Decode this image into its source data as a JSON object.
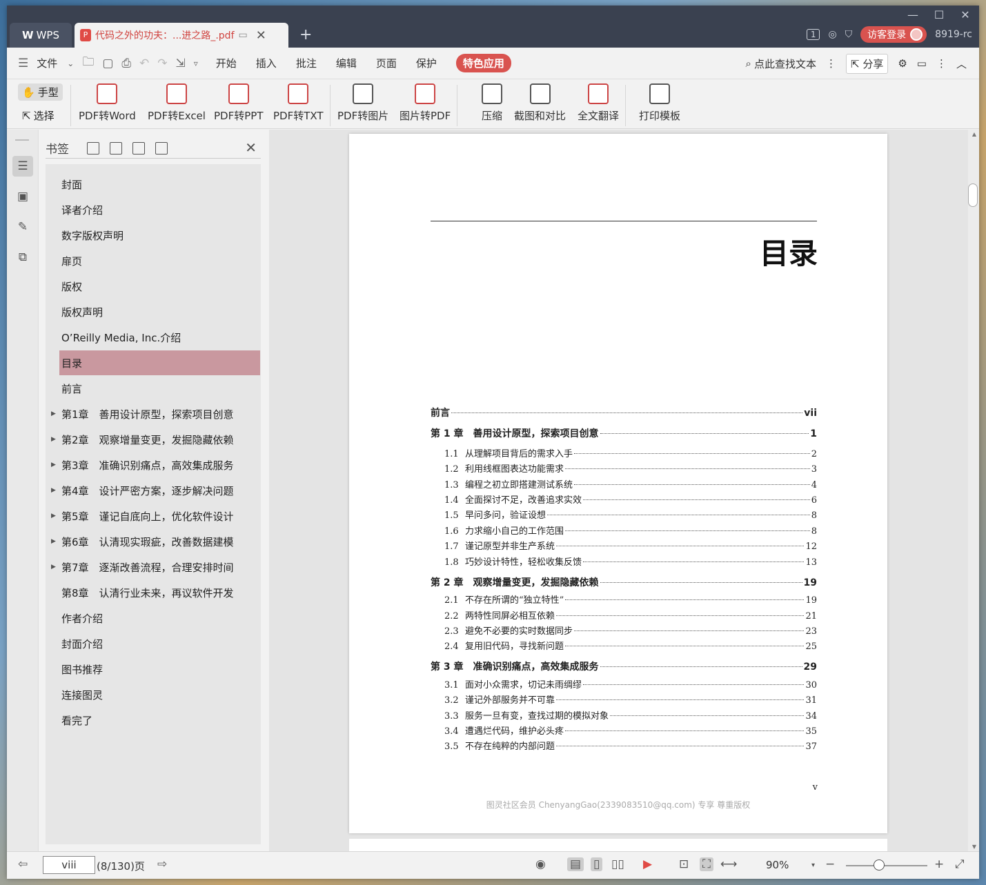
{
  "titlebar": {
    "app_tab": "WPS",
    "doc_tab": "代码之外的功夫：...进之路_.pdf",
    "page_count_badge": "1",
    "login_label": "访客登录",
    "user_code": "8919-rc"
  },
  "menubar": {
    "file_label": "文件",
    "items": [
      "开始",
      "插入",
      "批注",
      "编辑",
      "页面",
      "保护"
    ],
    "special_item": "特色应用",
    "search_label": "点此查找文本",
    "share_label": "分享"
  },
  "ribbon": {
    "hand_label": "手型",
    "select_label": "选择",
    "buttons": [
      "PDF转Word",
      "PDF转Excel",
      "PDF转PPT",
      "PDF转TXT",
      "PDF转图片",
      "图片转PDF",
      "压缩",
      "截图和对比",
      "全文翻译",
      "打印模板"
    ]
  },
  "bookmarks": {
    "title": "书签",
    "items": [
      {
        "label": "封面"
      },
      {
        "label": "译者介绍"
      },
      {
        "label": "数字版权声明"
      },
      {
        "label": "扉页"
      },
      {
        "label": "版权"
      },
      {
        "label": "版权声明"
      },
      {
        "label": "O’Reilly Media, Inc.介绍"
      },
      {
        "label": "目录"
      },
      {
        "label": "前言"
      },
      {
        "label": "第1章　善用设计原型，探索项目创意"
      },
      {
        "label": "第2章　观察增量变更，发掘隐藏依赖"
      },
      {
        "label": "第3章　准确识别痛点，高效集成服务"
      },
      {
        "label": "第4章　设计严密方案，逐步解决问题"
      },
      {
        "label": "第5章　谨记自底向上，优化软件设计"
      },
      {
        "label": "第6章　认清现实瑕疵，改善数据建模"
      },
      {
        "label": "第7章　逐渐改善流程，合理安排时间"
      },
      {
        "label": "第8章　认清行业未来，再议软件开发"
      },
      {
        "label": "作者介绍"
      },
      {
        "label": "封面介绍"
      },
      {
        "label": "图书推荐"
      },
      {
        "label": "连接图灵"
      },
      {
        "label": "看完了"
      }
    ]
  },
  "page": {
    "title": "目录",
    "toc": [
      {
        "num": "",
        "text": "前言",
        "page": "vii",
        "kind": "chap"
      },
      {
        "num": "",
        "text": "第 1 章　善用设计原型，探索项目创意",
        "page": "1",
        "kind": "chap"
      },
      {
        "num": "1.1",
        "text": "从理解项目背后的需求入手",
        "page": "2",
        "kind": "sec"
      },
      {
        "num": "1.2",
        "text": "利用线框图表达功能需求",
        "page": "3",
        "kind": "sec"
      },
      {
        "num": "1.3",
        "text": "编程之初立即搭建测试系统",
        "page": "4",
        "kind": "sec"
      },
      {
        "num": "1.4",
        "text": "全面探讨不足，改善追求实效",
        "page": "6",
        "kind": "sec"
      },
      {
        "num": "1.5",
        "text": "早问多问，验证设想",
        "page": "8",
        "kind": "sec"
      },
      {
        "num": "1.6",
        "text": "力求缩小自己的工作范围",
        "page": "8",
        "kind": "sec"
      },
      {
        "num": "1.7",
        "text": "谨记原型并非生产系统",
        "page": "12",
        "kind": "sec"
      },
      {
        "num": "1.8",
        "text": "巧妙设计特性，轻松收集反馈",
        "page": "13",
        "kind": "sec"
      },
      {
        "num": "",
        "text": "第 2 章　观察增量变更，发掘隐藏依赖",
        "page": "19",
        "kind": "chap"
      },
      {
        "num": "2.1",
        "text": "不存在所谓的“独立特性”",
        "page": "19",
        "kind": "sec"
      },
      {
        "num": "2.2",
        "text": "两特性同屏必相互依赖",
        "page": "21",
        "kind": "sec"
      },
      {
        "num": "2.3",
        "text": "避免不必要的实时数据同步",
        "page": "23",
        "kind": "sec"
      },
      {
        "num": "2.4",
        "text": "复用旧代码，寻找新问题",
        "page": "25",
        "kind": "sec"
      },
      {
        "num": "",
        "text": "第 3 章　准确识别痛点，高效集成服务",
        "page": "29",
        "kind": "chap"
      },
      {
        "num": "3.1",
        "text": "面对小众需求，切记未雨绸缪",
        "page": "30",
        "kind": "sec"
      },
      {
        "num": "3.2",
        "text": "谨记外部服务并不可靠",
        "page": "31",
        "kind": "sec"
      },
      {
        "num": "3.3",
        "text": "服务一旦有变，查找过期的模拟对象",
        "page": "34",
        "kind": "sec"
      },
      {
        "num": "3.4",
        "text": "遭遇烂代码，维护必头疼",
        "page": "35",
        "kind": "sec"
      },
      {
        "num": "3.5",
        "text": "不存在纯粹的内部问题",
        "page": "37",
        "kind": "sec"
      }
    ],
    "page_number": "v",
    "watermark": "图灵社区会员 ChenyangGao(2339083510@qq.com) 专享 尊重版权"
  },
  "status": {
    "page_input": "viii",
    "page_total": "(8/130)页",
    "zoom": "90%"
  },
  "colors": {
    "accent": "#d9534f",
    "titlebar": "#3a4150",
    "active_bookmark": "#c9989f"
  }
}
